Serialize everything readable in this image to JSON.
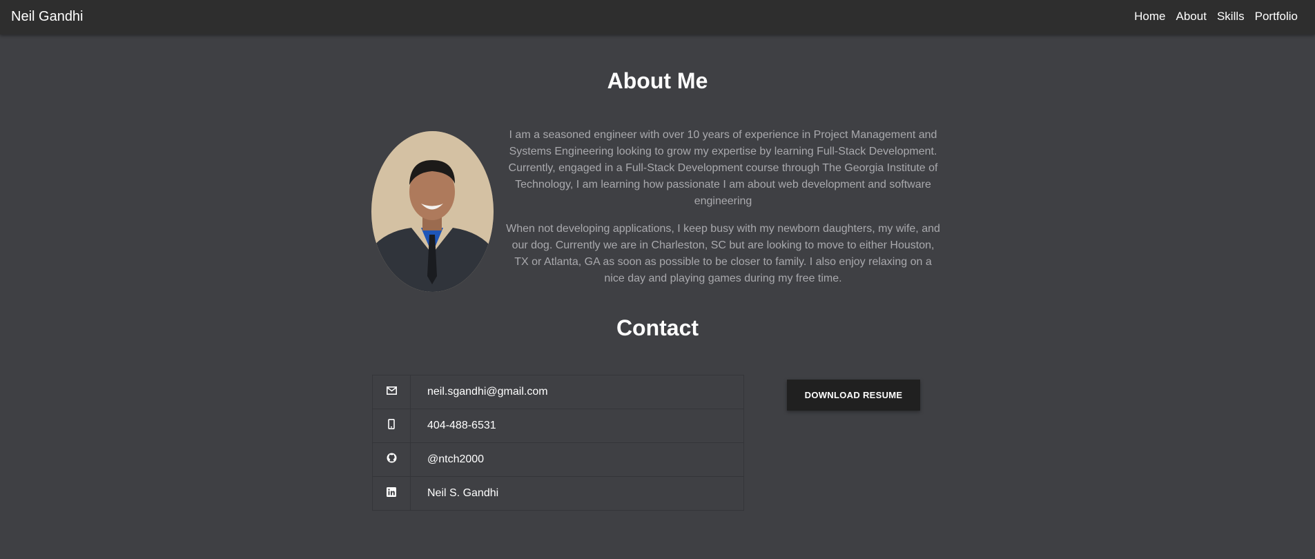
{
  "nav": {
    "brand": "Neil Gandhi",
    "links": [
      "Home",
      "About",
      "Skills",
      "Portfolio"
    ]
  },
  "about": {
    "title": "About Me",
    "paragraphs": [
      "I am a seasoned engineer with over 10 years of experience in Project Management and Systems Engineering looking to grow my expertise by learning Full-Stack Development. Currently, engaged in a Full-Stack Development course through The Georgia Institute of Technology, I am learning how passionate I am about web development and software engineering",
      "When not developing applications, I keep busy with my newborn daughters, my wife, and our dog. Currently we are in Charleston, SC but are looking to move to either Houston, TX or Atlanta, GA as soon as possible to be closer to family. I also enjoy relaxing on a nice day and playing games during my free time."
    ]
  },
  "contact": {
    "title": "Contact",
    "rows": [
      {
        "icon": "envelope-icon",
        "value": "neil.sgandhi@gmail.com"
      },
      {
        "icon": "mobile-phone-icon",
        "value": "404-488-6531"
      },
      {
        "icon": "github-icon",
        "value": "@ntch2000"
      },
      {
        "icon": "linkedin-icon",
        "value": "Neil S. Gandhi"
      }
    ],
    "resume_button": "DOWNLOAD RESUME"
  },
  "colors": {
    "background": "#3f4044",
    "navbar": "#2e2e2e",
    "body_text": "#a9a9ad",
    "button": "#202020"
  }
}
